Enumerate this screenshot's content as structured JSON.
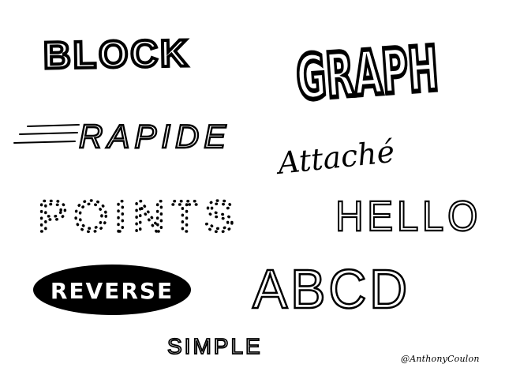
{
  "lettering": [
    {
      "style": "block",
      "text": "BLOCK"
    },
    {
      "style": "graphic",
      "text": "GRAPH"
    },
    {
      "style": "speed",
      "text": "RAPIDE"
    },
    {
      "style": "script",
      "text": "Attaché"
    },
    {
      "style": "dotted",
      "text": "POINTS"
    },
    {
      "style": "double-line",
      "text": "HELLO"
    },
    {
      "style": "reverse",
      "text": "REVERSE"
    },
    {
      "style": "thin-serif",
      "text": "ABCD"
    },
    {
      "style": "simple",
      "text": "SIMPLE"
    }
  ],
  "signature": "@AnthonyCoulon",
  "colors": {
    "ink": "#000000",
    "paper": "#ffffff"
  }
}
